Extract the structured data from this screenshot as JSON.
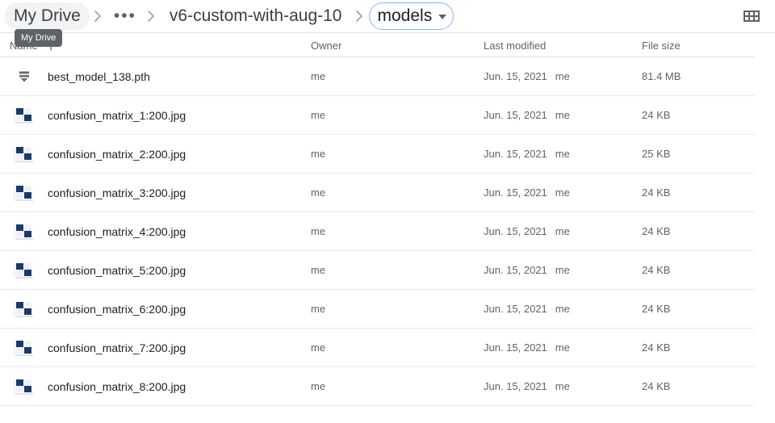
{
  "breadcrumb": {
    "root_label": "My Drive",
    "ellipsis_label": "•••",
    "parent_label": "v6-custom-with-aug-10",
    "current_label": "models",
    "tooltip": "My Drive"
  },
  "toolbar": {
    "grid_view_icon": "grid-view-icon"
  },
  "table": {
    "columns": {
      "name": "Name",
      "owner": "Owner",
      "modified": "Last modified",
      "size": "File size"
    },
    "sort": {
      "column": "Name",
      "direction": "ascending",
      "icon": "arrow-up-icon"
    },
    "rows": [
      {
        "icon": "binary-file-icon",
        "name": "best_model_138.pth",
        "owner": "me",
        "modified_date": "Jun. 15, 2021",
        "modified_by": "me",
        "size": "81.4 MB"
      },
      {
        "icon": "image-thumbnail-icon",
        "name": "confusion_matrix_1:200.jpg",
        "owner": "me",
        "modified_date": "Jun. 15, 2021",
        "modified_by": "me",
        "size": "24 KB"
      },
      {
        "icon": "image-thumbnail-icon",
        "name": "confusion_matrix_2:200.jpg",
        "owner": "me",
        "modified_date": "Jun. 15, 2021",
        "modified_by": "me",
        "size": "25 KB"
      },
      {
        "icon": "image-thumbnail-icon",
        "name": "confusion_matrix_3:200.jpg",
        "owner": "me",
        "modified_date": "Jun. 15, 2021",
        "modified_by": "me",
        "size": "24 KB"
      },
      {
        "icon": "image-thumbnail-icon",
        "name": "confusion_matrix_4:200.jpg",
        "owner": "me",
        "modified_date": "Jun. 15, 2021",
        "modified_by": "me",
        "size": "24 KB"
      },
      {
        "icon": "image-thumbnail-icon",
        "name": "confusion_matrix_5:200.jpg",
        "owner": "me",
        "modified_date": "Jun. 15, 2021",
        "modified_by": "me",
        "size": "24 KB"
      },
      {
        "icon": "image-thumbnail-icon",
        "name": "confusion_matrix_6:200.jpg",
        "owner": "me",
        "modified_date": "Jun. 15, 2021",
        "modified_by": "me",
        "size": "24 KB"
      },
      {
        "icon": "image-thumbnail-icon",
        "name": "confusion_matrix_7:200.jpg",
        "owner": "me",
        "modified_date": "Jun. 15, 2021",
        "modified_by": "me",
        "size": "24 KB"
      },
      {
        "icon": "image-thumbnail-icon",
        "name": "confusion_matrix_8:200.jpg",
        "owner": "me",
        "modified_date": "Jun. 15, 2021",
        "modified_by": "me",
        "size": "24 KB"
      }
    ]
  },
  "colors": {
    "accent": "#8ab4f8",
    "text_primary": "#202124",
    "text_secondary": "#5f6368",
    "divider": "#e8eaed",
    "thumbnail_dark": "#1b3a6b",
    "tooltip_bg": "#5f6368"
  }
}
